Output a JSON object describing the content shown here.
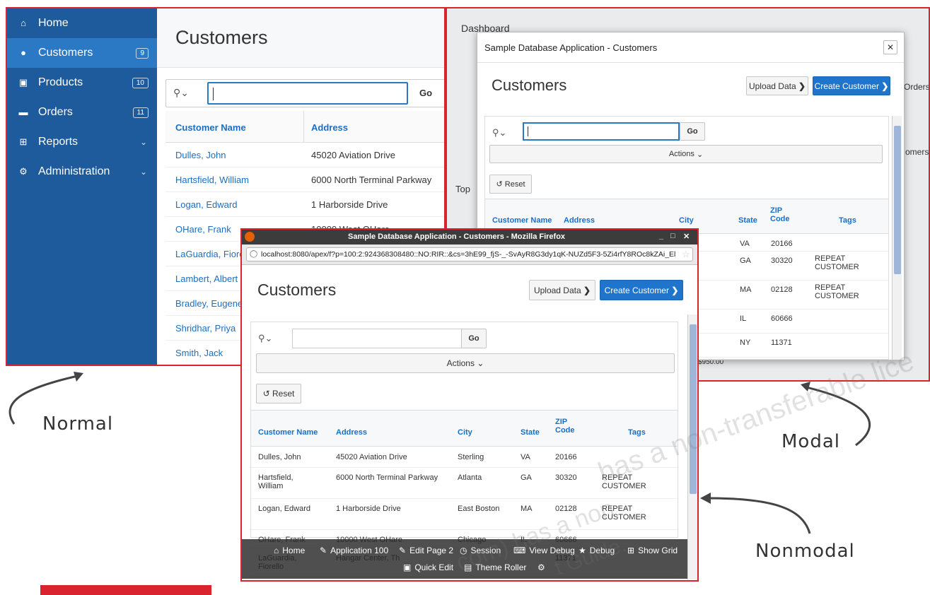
{
  "normal": {
    "sidebar": {
      "items": [
        {
          "label": "Home",
          "icon": "home-icon"
        },
        {
          "label": "Customers",
          "icon": "users-icon",
          "badge": "9",
          "active": true
        },
        {
          "label": "Products",
          "icon": "cart-icon",
          "badge": "10"
        },
        {
          "label": "Orders",
          "icon": "card-icon",
          "badge": "11"
        },
        {
          "label": "Reports",
          "icon": "grid-icon",
          "chevron": true
        },
        {
          "label": "Administration",
          "icon": "gear-icon",
          "chevron": true
        }
      ]
    },
    "title": "Customers",
    "search": {
      "value": "",
      "go": "Go"
    },
    "columns": [
      "Customer Name",
      "Address"
    ],
    "rows": [
      [
        "Dulles, John",
        "45020 Aviation Drive"
      ],
      [
        "Hartsfield, William",
        "6000 North Terminal Parkway"
      ],
      [
        "Logan, Edward",
        "1 Harborside Drive"
      ],
      [
        "OHare, Frank",
        "10000 West OHare"
      ],
      [
        "LaGuardia, Fiorello",
        ""
      ],
      [
        "Lambert, Albert",
        ""
      ],
      [
        "Bradley, Eugene",
        ""
      ],
      [
        "Shridhar, Priya",
        ""
      ],
      [
        "Smith, Jack",
        ""
      ]
    ]
  },
  "modal": {
    "background": {
      "dashboard": "Dashboard",
      "top_label": "Top",
      "orders": "Orders",
      "customers": "omers",
      "amount": "$950.00"
    },
    "dialog_title": "Sample Database Application - Customers",
    "page_title": "Customers",
    "upload": "Upload Data",
    "create": "Create Customer",
    "go": "Go",
    "actions": "Actions",
    "reset": "Reset",
    "columns": [
      "Customer Name",
      "Address",
      "City",
      "State",
      "ZIP Code",
      "Tags"
    ],
    "rows": [
      {
        "city": "g",
        "state": "VA",
        "zip": "20166",
        "tags": ""
      },
      {
        "city": "",
        "state": "GA",
        "zip": "30320",
        "tags": "REPEAT CUSTOMER"
      },
      {
        "city": "oston",
        "state": "MA",
        "zip": "02128",
        "tags": "REPEAT CUSTOMER"
      },
      {
        "city": "o",
        "state": "IL",
        "zip": "60666",
        "tags": ""
      },
      {
        "city": "g",
        "state": "NY",
        "zip": "11371",
        "tags": ""
      }
    ]
  },
  "nonmodal": {
    "window_title": "Sample Database Application - Customers - Mozilla Firefox",
    "url": "localhost:8080/apex/f?p=100:2:924368308480::NO:RIR::&cs=3hE99_fjS-_-SvAyR8G3dy1qK-NUZd5F3-5Zi4rfY8ROc8kZAi_El",
    "page_title": "Customers",
    "upload": "Upload Data",
    "create": "Create Customer",
    "go": "Go",
    "actions": "Actions",
    "reset": "Reset",
    "columns": [
      "Customer Name",
      "Address",
      "City",
      "State",
      "ZIP Code",
      "Tags"
    ],
    "rows": [
      {
        "name": "Dulles, John",
        "address": "45020 Aviation Drive",
        "city": "Sterling",
        "state": "VA",
        "zip": "20166",
        "tags": ""
      },
      {
        "name": "Hartsfield, William",
        "address": "6000 North Terminal Parkway",
        "city": "Atlanta",
        "state": "GA",
        "zip": "30320",
        "tags": "REPEAT CUSTOMER"
      },
      {
        "name": "Logan, Edward",
        "address": "1 Harborside Drive",
        "city": "East Boston",
        "state": "MA",
        "zip": "02128",
        "tags": "REPEAT CUSTOMER"
      },
      {
        "name": "OHare, Frank",
        "address": "10000 West OHare",
        "city": "Chicago",
        "state": "IL",
        "zip": "60666",
        "tags": ""
      },
      {
        "name": "LaGuardia, Fiorello",
        "address": "Hangar Center, Th",
        "city": "",
        "state": "",
        "zip": "11371",
        "tags": ""
      }
    ],
    "devbar": [
      "Home",
      "Application 100",
      "Edit Page 2",
      "Session",
      "View Debug",
      "Debug",
      "Show Grid",
      "Quick Edit",
      "Theme Roller"
    ]
  },
  "annotations": {
    "normal": "Normal",
    "modal": "Modal",
    "nonmodal": "Nonmodal"
  },
  "watermark": {
    "line1": "has a non-transferable lice",
    "line2": "com) has a non",
    "line3": "t Guide."
  },
  "colors": {
    "accent_red": "#d9232e",
    "sidebar_blue": "#1e5b9c",
    "primary_blue": "#1f75cc"
  }
}
